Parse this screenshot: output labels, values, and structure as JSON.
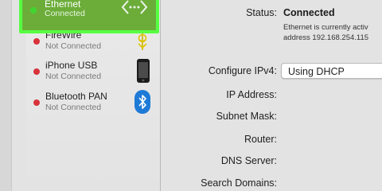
{
  "sidebar": {
    "items": [
      {
        "name": "Ethernet",
        "status": "Connected",
        "dot_color": "#41d62f",
        "icon": "ethernet-arrows-icon",
        "selected": true
      },
      {
        "name": "FireWire",
        "status": "Not Connected",
        "dot_color": "#d8323a",
        "icon": "firewire-icon"
      },
      {
        "name": "iPhone USB",
        "status": "Not Connected",
        "dot_color": "#d8323a",
        "icon": "iphone-icon"
      },
      {
        "name": "Bluetooth PAN",
        "status": "Not Connected",
        "dot_color": "#d8323a",
        "icon": "bluetooth-icon"
      }
    ]
  },
  "detail": {
    "status_label": "Status:",
    "status_value": "Connected",
    "status_desc_line1": "Ethernet is currently activ",
    "status_desc_line2": "address 192.168.254.115",
    "configure_label": "Configure IPv4:",
    "configure_value": "Using DHCP",
    "ip_label": "IP Address:",
    "subnet_label": "Subnet Mask:",
    "router_label": "Router:",
    "dns_label": "DNS Server:",
    "search_domains_label": "Search Domains:"
  },
  "colors": {
    "highlight_border": "#57ff42",
    "selected_bg": "#6cad3a",
    "connected_dot": "#41d62f",
    "disconnected_dot": "#d8323a",
    "bluetooth_blue": "#1e7ad7"
  }
}
